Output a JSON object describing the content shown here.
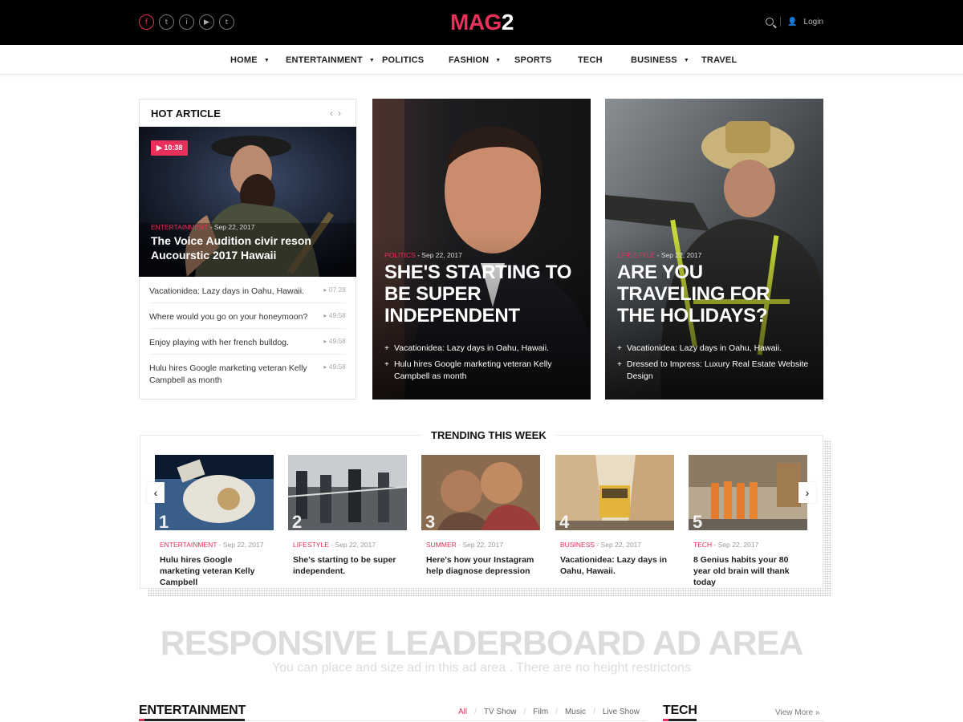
{
  "header": {
    "logo_main": "MAG",
    "logo_num": "2",
    "login": "Login",
    "social": [
      "f",
      "t",
      "i",
      "▶",
      "t"
    ]
  },
  "nav": [
    {
      "label": "HOME",
      "dropdown": true
    },
    {
      "label": "ENTERTAINMENT",
      "dropdown": true
    },
    {
      "label": "POLITICS",
      "dropdown": false
    },
    {
      "label": "FASHION",
      "dropdown": true
    },
    {
      "label": "SPORTS",
      "dropdown": false
    },
    {
      "label": "TECH",
      "dropdown": false
    },
    {
      "label": "BUSINESS",
      "dropdown": true
    },
    {
      "label": "TRAVEL",
      "dropdown": false
    }
  ],
  "hot": {
    "heading": "HOT ARTICLE",
    "badge": "10:38",
    "category": "ENTERTAINMENT",
    "date": "- Sep 22, 2017",
    "title": "The Voice Audition civir reson Aucourstic 2017 Hawaii",
    "list": [
      {
        "title": "Vacationidea: Lazy days in Oahu, Hawaii.",
        "time": "07:28"
      },
      {
        "title": "Where would you go on your honeymoon?",
        "time": "49:58"
      },
      {
        "title": "Enjoy playing with her french bulldog.",
        "time": "49:58"
      },
      {
        "title": "Hulu hires Google marketing veteran Kelly Campbell as month",
        "time": "49:58"
      }
    ]
  },
  "features": [
    {
      "category": "POLITICS",
      "date": "- Sep 22, 2017",
      "title": "SHE'S STARTING TO BE SUPER INDEPENDENT",
      "bullets": [
        "Vacationidea: Lazy days in Oahu, Hawaii.",
        "Hulu hires Google marketing veteran Kelly Campbell as month"
      ]
    },
    {
      "category": "LIFE STYLE",
      "date": "- Sep 22, 2017",
      "title": "ARE YOU TRAVELING FOR THE HOLIDAYS?",
      "bullets": [
        "Vacationidea: Lazy days in Oahu, Hawaii.",
        "Dressed to Impress: Luxury Real Estate Website Design"
      ]
    }
  ],
  "trending": {
    "heading": "TRENDING THIS WEEK",
    "items": [
      {
        "num": "1",
        "category": "ENTERTAINMENT",
        "date": "- Sep 22, 2017",
        "title": "Hulu hires Google marketing veteran Kelly Campbell"
      },
      {
        "num": "2",
        "category": "LIFESTYLE",
        "date": "- Sep 22, 2017",
        "title": "She's starting to be super independent."
      },
      {
        "num": "3",
        "category": "SUMMER",
        "date": "- Sep 22, 2017",
        "title": "Here's how your Instagram help diagnose depression"
      },
      {
        "num": "4",
        "category": "BUSINESS",
        "date": "- Sep 22, 2017",
        "title": "Vacationidea: Lazy days in Oahu, Hawaii."
      },
      {
        "num": "5",
        "category": "TECH",
        "date": "- Sep 22, 2017",
        "title": "8 Genius habits your 80 year old brain will thank today"
      }
    ]
  },
  "ad": {
    "title": "RESPONSIVE LEADERBOARD AD  AREA",
    "subtitle": "You can place and size ad in this ad area . There are no height restrictons"
  },
  "entertainment": {
    "heading": "ENTERTAINMENT",
    "filters": [
      "All",
      "TV Show",
      "Film",
      "Music",
      "Live Show"
    ]
  },
  "tech": {
    "heading": "TECH",
    "view_more": "View More"
  }
}
